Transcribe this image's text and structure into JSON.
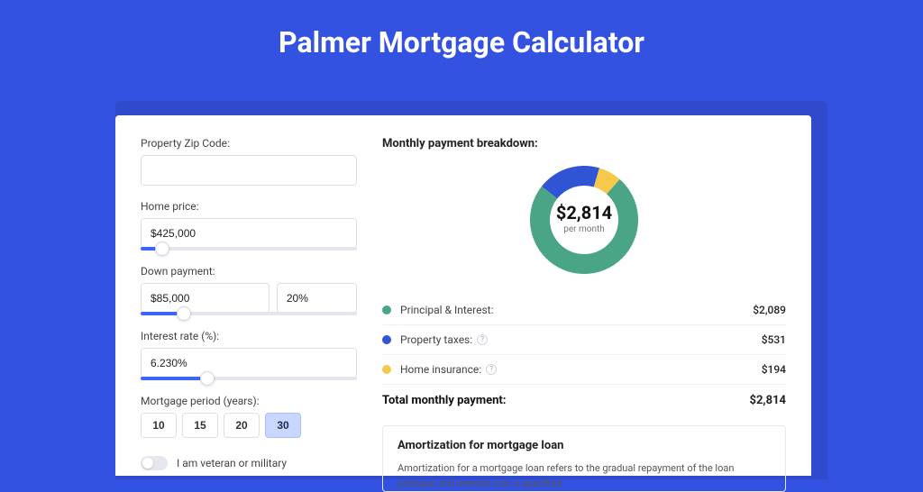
{
  "title": "Palmer Mortgage Calculator",
  "form": {
    "zip_label": "Property Zip Code:",
    "zip_value": "",
    "home_price_label": "Home price:",
    "home_price_value": "$425,000",
    "home_price_slider_pct": 10,
    "down_payment_label": "Down payment:",
    "down_payment_value": "$85,000",
    "down_payment_pct": "20%",
    "down_payment_slider_pct": 20,
    "interest_label": "Interest rate (%):",
    "interest_value": "6.230%",
    "interest_slider_pct": 31,
    "period_label": "Mortgage period (years):",
    "periods": [
      "10",
      "15",
      "20",
      "30"
    ],
    "period_active_index": 3,
    "veteran_label": "I am veteran or military",
    "veteran_on": false
  },
  "breakdown": {
    "title": "Monthly payment breakdown:",
    "center_value": "$2,814",
    "center_sub": "per month",
    "items": [
      {
        "label": "Principal & Interest:",
        "value": "$2,089",
        "color": "#4aa586",
        "info": false
      },
      {
        "label": "Property taxes:",
        "value": "$531",
        "color": "#2f55d4",
        "info": true
      },
      {
        "label": "Home insurance:",
        "value": "$194",
        "color": "#f4c94c",
        "info": true
      }
    ],
    "total_label": "Total monthly payment:",
    "total_value": "$2,814"
  },
  "chart_data": {
    "type": "pie",
    "title": "Monthly payment breakdown",
    "series": [
      {
        "name": "Principal & Interest",
        "value": 2089,
        "color": "#4aa586"
      },
      {
        "name": "Property taxes",
        "value": 531,
        "color": "#2f55d4"
      },
      {
        "name": "Home insurance",
        "value": 194,
        "color": "#f4c94c"
      }
    ],
    "total": 2814,
    "donut": true,
    "center_label": "$2,814 per month"
  },
  "amortization": {
    "title": "Amortization for mortgage loan",
    "text": "Amortization for a mortgage loan refers to the gradual repayment of the loan principal and interest over a specified"
  }
}
